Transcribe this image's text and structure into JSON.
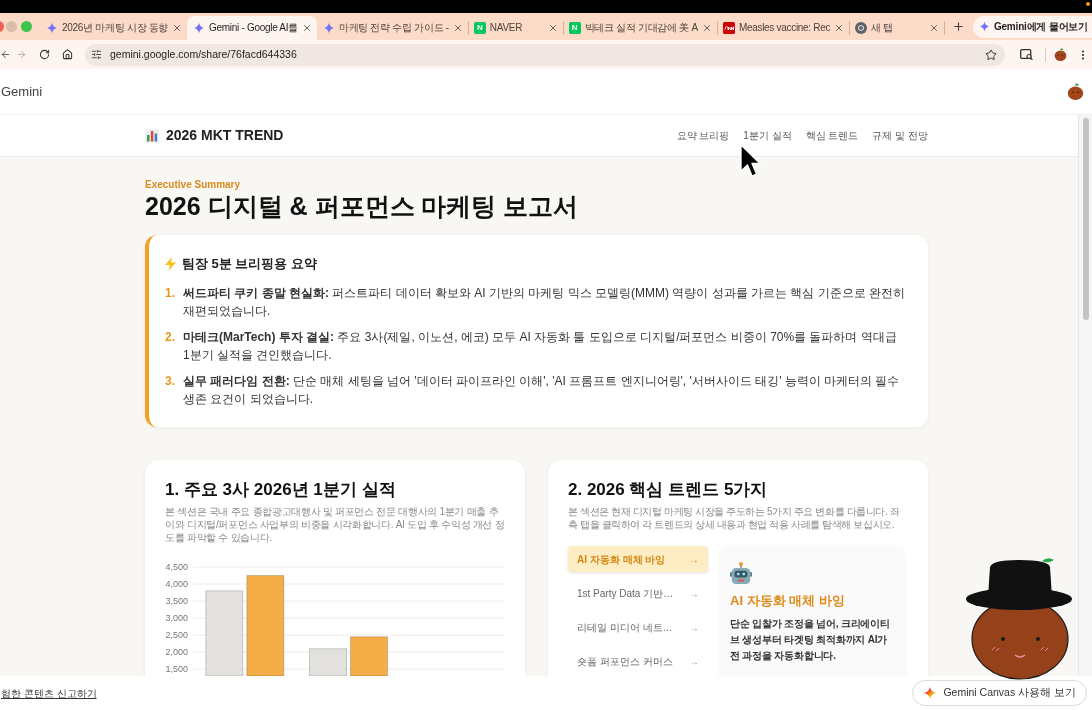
{
  "browser": {
    "tabs": [
      {
        "kind": "gemini",
        "title": "2026년 마케팅 시장 동향",
        "selected": false
      },
      {
        "kind": "gemini",
        "title": "Gemini - Google AI를",
        "selected": true
      },
      {
        "kind": "gemini",
        "title": "마케팅 전략 수립 가이드 -",
        "selected": false
      },
      {
        "kind": "naver",
        "favicon_label": "N",
        "title": "NAVER",
        "selected": false
      },
      {
        "kind": "naver",
        "favicon_label": "N",
        "title": "빅테크 실적 기대감에 美 A",
        "selected": false
      },
      {
        "kind": "news",
        "title": "Measles vaccine: Rec",
        "selected": false
      },
      {
        "kind": "browser",
        "title": "새 탭",
        "selected": false
      }
    ],
    "ask_gemini": "Gemini에게 물어보기",
    "address": "gemini.google.com/share/76facd644336"
  },
  "gemini_header": {
    "title": "Gemini"
  },
  "report": {
    "brand": "2026 MKT TREND",
    "nav": [
      "요약 브리핑",
      "1분기 실적",
      "핵심 트렌드",
      "규제 및 전망"
    ],
    "eyebrow": "Executive Summary",
    "title": "2026 디지털 & 퍼포먼스 마케팅 보고서",
    "summary": {
      "heading": "팀장 5분 브리핑용 요약",
      "items": [
        {
          "number": "1.",
          "text": "**써드파티 쿠키 종말 현실화:** 퍼스트파티 데이터 확보와 AI 기반의 마케팅 믹스 모델링(MMM) 역량이 성과를 가르는 핵심 기준으로 완전히 재편되었습니다."
        },
        {
          "number": "2.",
          "text": "**마테크(MarTech) 투자 결실:** 주요 3사(제일, 이노션, 에코) 모두 AI 자동화 툴 도입으로 디지털/퍼포먼스 비중이 70%를 돌파하며 역대급 1분기 실적을 견인했습니다."
        },
        {
          "number": "3.",
          "text": "**실무 패러다임 전환:** 단순 매체 세팅을 넘어 '데이터 파이프라인 이해', 'AI 프롬프트 엔지니어링', '서버사이드 태깅' 능력이 마케터의 필수 생존 요건이 되었습니다."
        }
      ]
    },
    "performance": {
      "title": "1. 주요 3사 2026년 1분기 실적",
      "description": "본 섹션은 국내 주요 종합광고대행사 및 퍼포먼스 전문 대행사의 1분기 매출 추이와 디지털/퍼포먼스 사업부의 비중을 시각화합니다. AI 도입 후 수익성 개선 정도를 파악할 수 있습니다.",
      "chart_data": {
        "type": "bar",
        "grid": true,
        "series": [
          {
            "color": "#e3e1dd",
            "values": [
              3800,
              2100,
              null
            ]
          },
          {
            "color": "#f5ad47",
            "values": [
              4250,
              2450,
              null
            ]
          }
        ],
        "ylim": [
          1300,
          4500
        ],
        "yticks": [
          {
            "value": 1500,
            "label": "1,500"
          },
          {
            "value": 2000,
            "label": "2,000"
          },
          {
            "value": 2500,
            "label": "2,500"
          },
          {
            "value": 3000,
            "label": "3,000"
          },
          {
            "value": 3500,
            "label": "3,500"
          },
          {
            "value": 4000,
            "label": "4,000"
          },
          {
            "value": 4500,
            "label": "4,500"
          }
        ]
      }
    },
    "trends": {
      "title": "2. 2026 핵심 트렌드 5가지",
      "description": "본 섹션은 현재 디지털 마케팅 시장을 주도하는 5가지 주요 변화를 다룹니다. 좌측 탭을 클릭하여 각 트렌드의 상세 내용과 현업 적용 사례를 탐색해 보십시오.",
      "tabs": [
        {
          "label": "AI 자동화 매체 바잉",
          "arrow": "→",
          "selected": true
        },
        {
          "label": "1st Party Data 기반…",
          "arrow": "→",
          "selected": false
        },
        {
          "label": "리테일 미디어 네트…",
          "arrow": "→",
          "selected": false
        },
        {
          "label": "숏폼 퍼포먼스 커머스",
          "arrow": "→",
          "selected": false
        }
      ],
      "detail": {
        "title": "AI 자동화 매체 바잉",
        "body": "단순 입찰가 조정을 넘어, 크리에이티브 생성부터 타겟팅 최적화까지 AI가 전 과정을 자동화합니다."
      }
    }
  },
  "footer": {
    "report_link": "험한 콘텐츠 신고하기",
    "canvas_button": "Gemini Canvas 사용해 보기"
  }
}
